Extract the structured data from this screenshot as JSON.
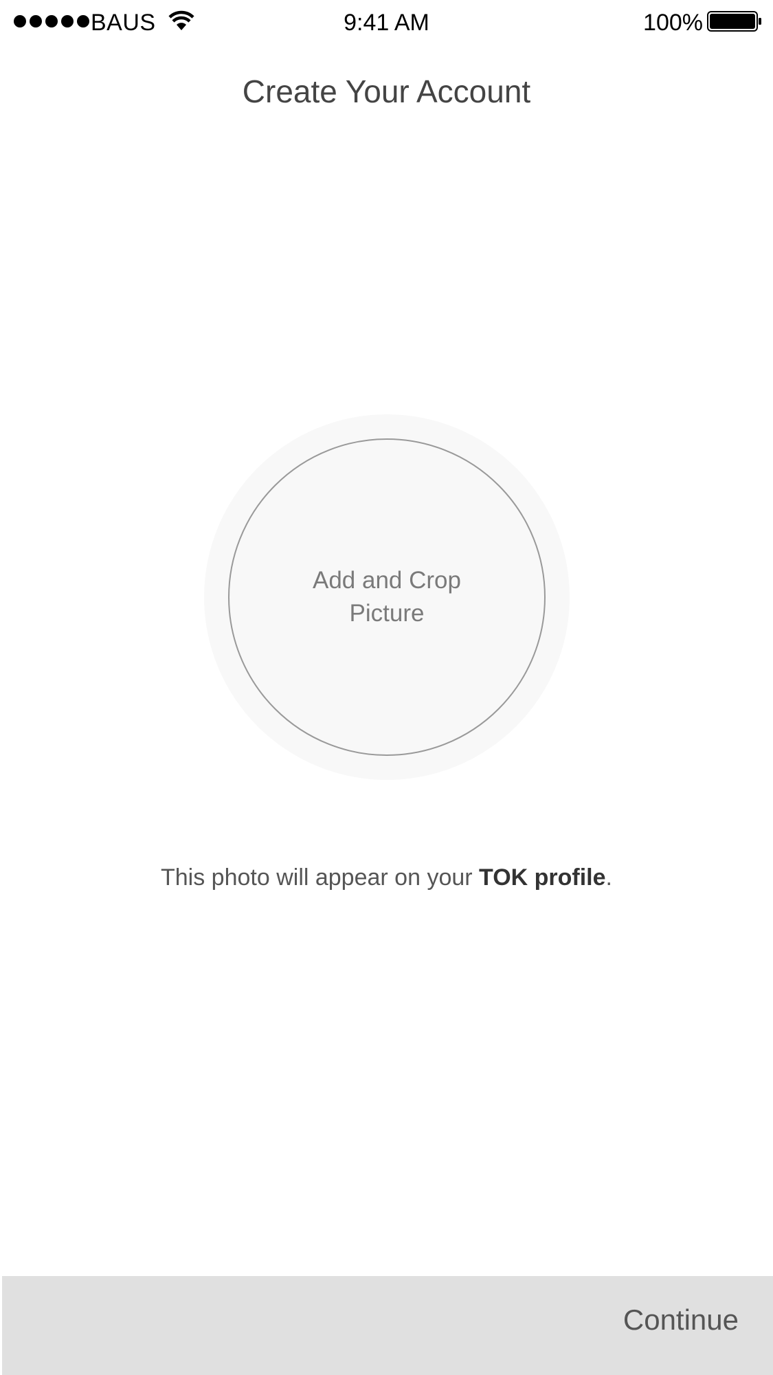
{
  "status_bar": {
    "carrier": "BAUS",
    "time": "9:41 AM",
    "battery_percent": "100%",
    "signal_bars": 5
  },
  "header": {
    "title": "Create Your Account"
  },
  "avatar": {
    "label": "Add and Crop Picture"
  },
  "helper": {
    "prefix": "This photo will appear on your ",
    "brand": "TOK profile",
    "suffix": "."
  },
  "footer": {
    "continue_label": "Continue"
  },
  "colors": {
    "background": "#ffffff",
    "circle_fill": "#f8f8f8",
    "circle_stroke": "#999999",
    "bottom_bar": "#e0e0e0",
    "text_dark": "#333333"
  }
}
